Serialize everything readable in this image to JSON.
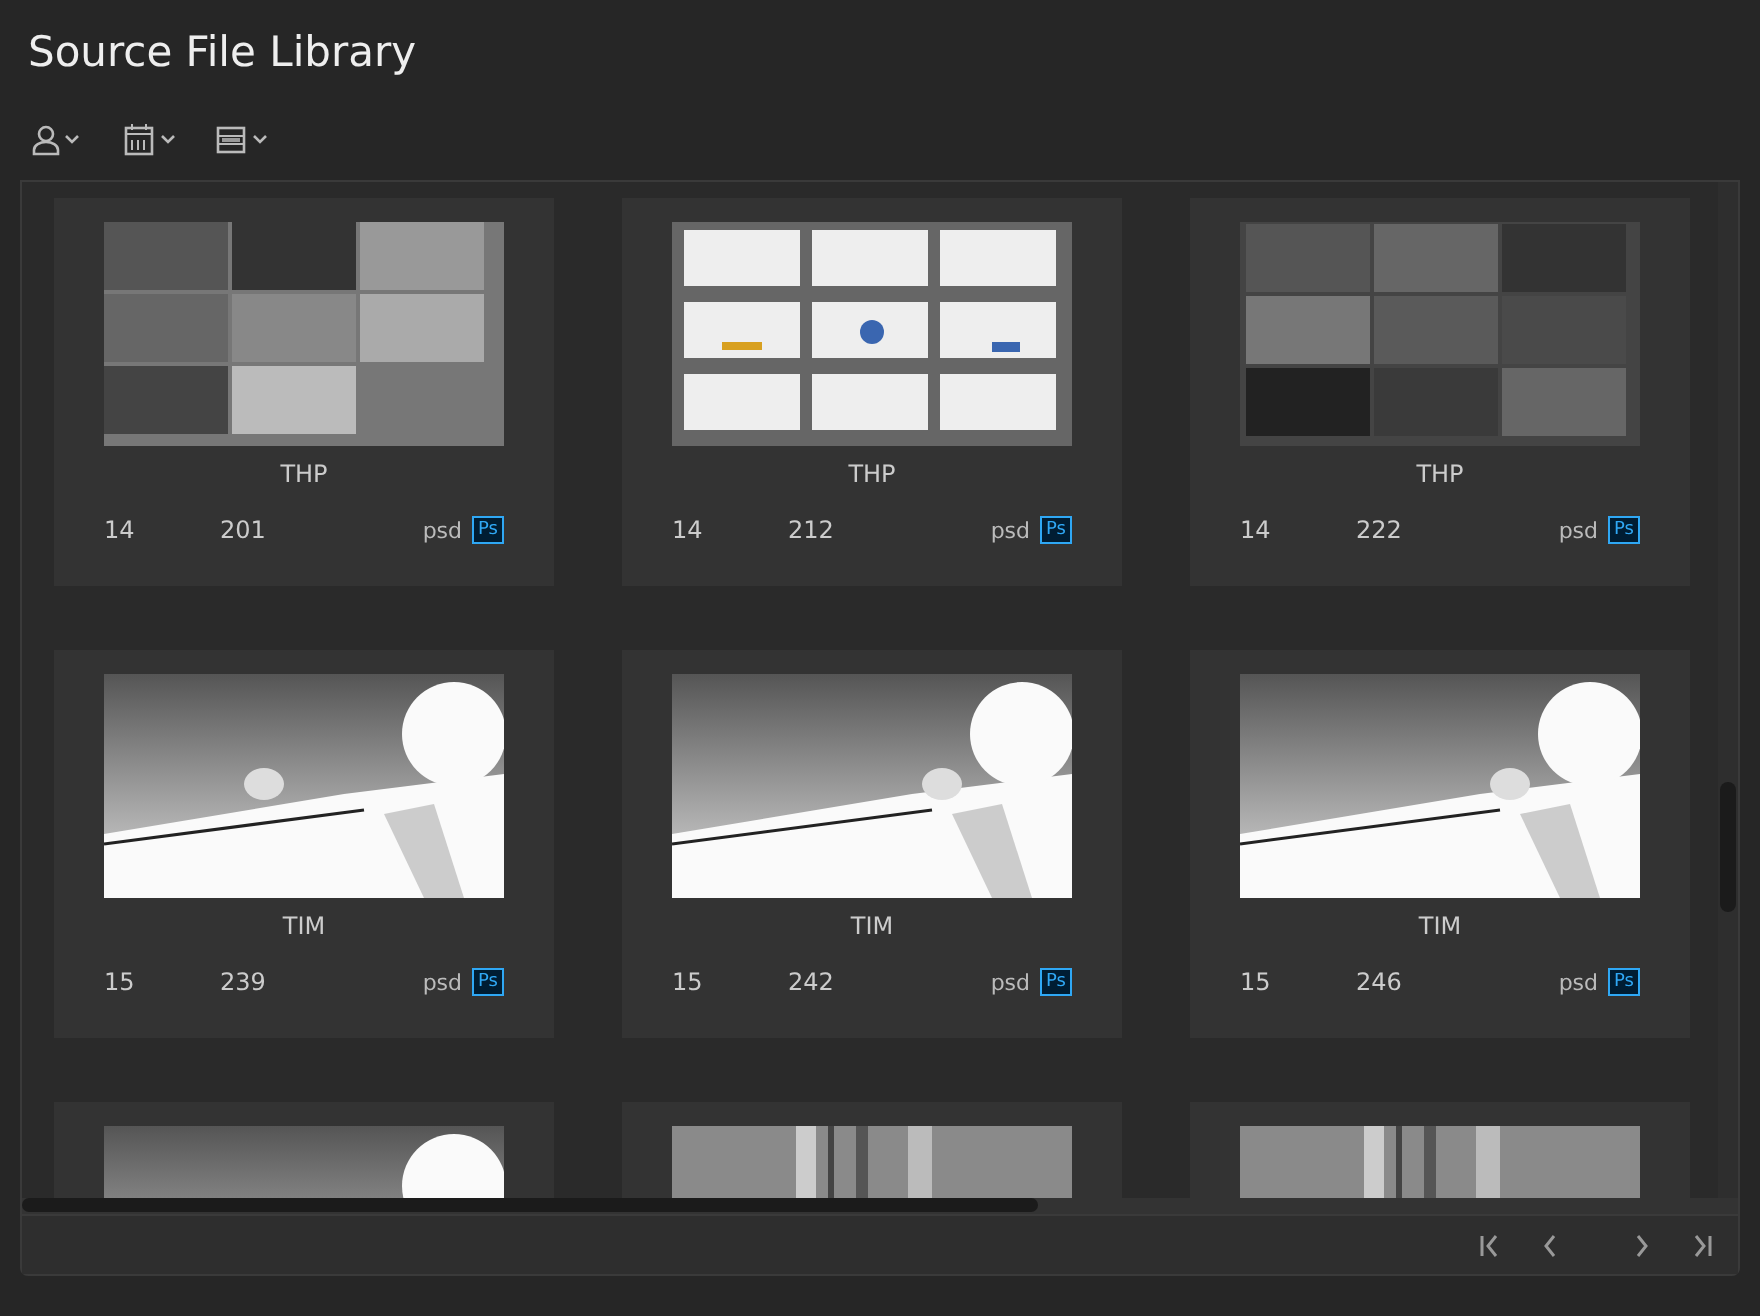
{
  "title": "Source File Library",
  "toolbar": [
    {
      "kind": "person"
    },
    {
      "kind": "calendar"
    },
    {
      "kind": "list"
    }
  ],
  "cards": [
    {
      "thumbnail": {
        "kind": "picture"
      },
      "name": "THP",
      "column_1": "14",
      "column_2": "201",
      "format": "psd",
      "badge": "Ps"
    },
    {
      "thumbnail": {
        "kind": "picture"
      },
      "name": "THP",
      "column_1": "14",
      "column_2": "212",
      "format": "psd",
      "badge": "Ps"
    },
    {
      "thumbnail": {
        "kind": "picture"
      },
      "name": "THP",
      "column_1": "14",
      "column_2": "222",
      "format": "psd",
      "badge": "Ps"
    },
    {
      "thumbnail": {
        "kind": "picture"
      },
      "name": "TIM",
      "column_1": "15",
      "column_2": "239",
      "format": "psd",
      "badge": "Ps"
    },
    {
      "thumbnail": {
        "kind": "picture"
      },
      "name": "TIM",
      "column_1": "15",
      "column_2": "242",
      "format": "psd",
      "badge": "Ps"
    },
    {
      "thumbnail": {
        "kind": "picture"
      },
      "name": "TIM",
      "column_1": "15",
      "column_2": "246",
      "format": "psd",
      "badge": "Ps"
    },
    {
      "thumbnail": {
        "kind": "picture"
      }
    },
    {
      "thumbnail": {
        "kind": "picture"
      }
    },
    {
      "thumbnail": {
        "kind": "picture"
      }
    }
  ],
  "pagination": [
    {
      "kind": "first"
    },
    {
      "kind": "prev"
    },
    {
      "kind": "next"
    },
    {
      "kind": "last"
    }
  ]
}
